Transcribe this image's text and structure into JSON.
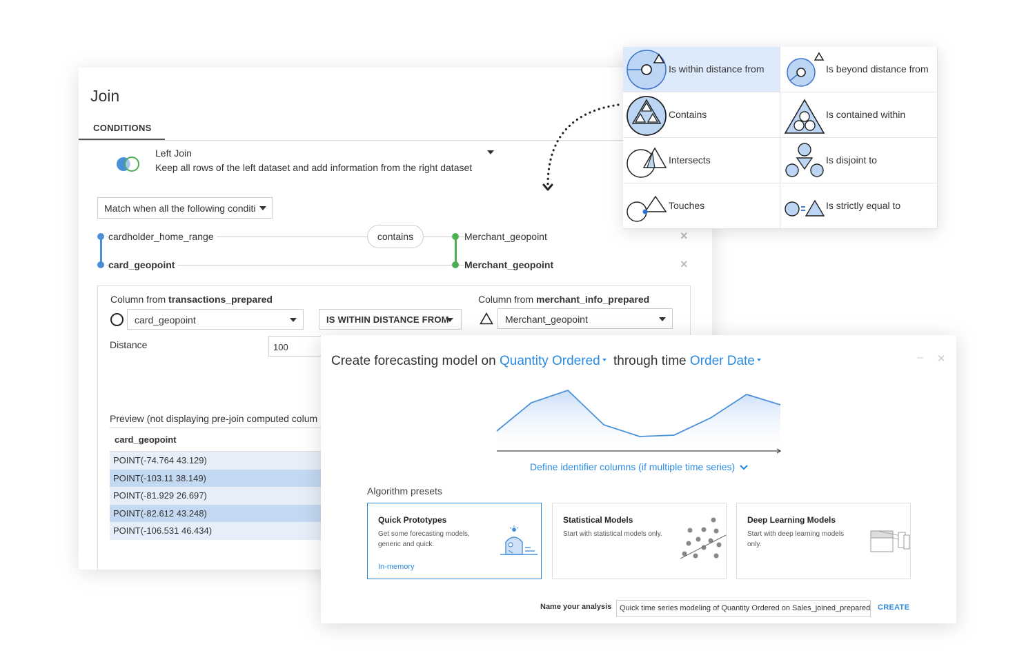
{
  "join": {
    "title": "Join",
    "tab": "CONDITIONS",
    "join_type": {
      "name": "Left Join",
      "description": "Keep all rows of the left dataset and add information from the right dataset"
    },
    "match_select": "Match when all the following conditi",
    "conditions": [
      {
        "left": "cardholder_home_range",
        "operator": "contains",
        "right": "Merchant_geopoint"
      },
      {
        "left": "card_geopoint",
        "right": "Merchant_geopoint"
      }
    ],
    "detail": {
      "left_prefix": "Column from ",
      "left_dataset": "transactions_prepared",
      "right_prefix": "Column from ",
      "right_dataset": "merchant_info_prepared",
      "left_column": "card_geopoint",
      "operator": "IS WITHIN DISTANCE FROM",
      "right_column": "Merchant_geopoint",
      "distance_label": "Distance",
      "distance_value": "100",
      "preview_label": "Preview (not displaying pre-join computed colum",
      "preview_header": "card_geopoint",
      "preview_rows": [
        "POINT(-74.764 43.129)",
        "POINT(-103.11 38.149)",
        "POINT(-81.929 26.697)",
        "POINT(-82.612 43.248)",
        "POINT(-106.531 46.434)"
      ]
    }
  },
  "spatial_operators": [
    {
      "label": "Is within distance from",
      "icon": "within-distance-icon",
      "selected": true
    },
    {
      "label": "Is beyond distance from",
      "icon": "beyond-distance-icon",
      "selected": false
    },
    {
      "label": "Contains",
      "icon": "contains-icon",
      "selected": false
    },
    {
      "label": "Is contained within",
      "icon": "contained-within-icon",
      "selected": false
    },
    {
      "label": "Intersects",
      "icon": "intersects-icon",
      "selected": false
    },
    {
      "label": "Is disjoint to",
      "icon": "disjoint-icon",
      "selected": false
    },
    {
      "label": "Touches",
      "icon": "touches-icon",
      "selected": false
    },
    {
      "label": "Is strictly equal to",
      "icon": "strictly-equal-icon",
      "selected": false
    }
  ],
  "forecast": {
    "title_prefix": "Create forecasting model on ",
    "target": "Quantity Ordered",
    "title_middle": " through time ",
    "time_column": "Order Date",
    "define_link": "Define identifier columns (if multiple time series)",
    "presets_label": "Algorithm presets",
    "presets": [
      {
        "title": "Quick Prototypes",
        "description": "Get some forecasting models, generic and quick.",
        "footer": "In-memory",
        "selected": true
      },
      {
        "title": "Statistical Models",
        "description": "Start with statistical models only.",
        "footer": "",
        "selected": false
      },
      {
        "title": "Deep Learning Models",
        "description": "Start with deep learning models only.",
        "footer": "",
        "selected": false
      }
    ],
    "name_label": "Name your analysis",
    "name_value": "Quick time series modeling of Quantity Ordered on Sales_joined_prepared",
    "create_label": "CREATE"
  },
  "colors": {
    "accent_blue": "#2b8ae0",
    "condition_left": "#4a90d9",
    "condition_right": "#4caf50",
    "selected_cell": "#ddeafb",
    "preview_row_dark": "#c3d8f1"
  }
}
